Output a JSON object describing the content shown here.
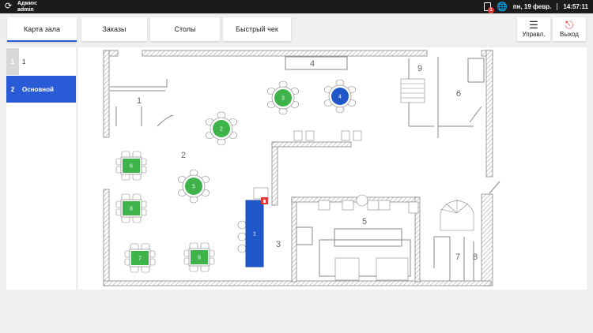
{
  "topbar": {
    "user_label": "Админ:",
    "user_name": "admin",
    "notif_count": "1",
    "date": "пн, 19 февр.",
    "time": "14:57:11"
  },
  "tabs": [
    "Карта зала",
    "Заказы",
    "Столы",
    "Быстрый чек"
  ],
  "actions": {
    "manage": "Управл.",
    "exit": "Выход"
  },
  "halls": [
    {
      "num": "1",
      "name": "1"
    },
    {
      "num": "2",
      "name": "Основной"
    }
  ],
  "rooms": [
    "1",
    "2",
    "3",
    "4",
    "5",
    "6",
    "7",
    "8",
    "9"
  ],
  "tables": [
    {
      "label": "1",
      "status": "selected"
    },
    {
      "label": "2",
      "status": "free"
    },
    {
      "label": "3",
      "status": "free"
    },
    {
      "label": "4",
      "status": "selected"
    },
    {
      "label": "5",
      "status": "free"
    },
    {
      "label": "6",
      "status": "free"
    },
    {
      "label": "7",
      "status": "free"
    },
    {
      "label": "8",
      "status": "free"
    },
    {
      "label": "9",
      "status": "free"
    }
  ],
  "colors": {
    "accent": "#2a5bd7",
    "free": "#3db34a",
    "selected": "#1f57c8",
    "lock": "#e53935"
  }
}
